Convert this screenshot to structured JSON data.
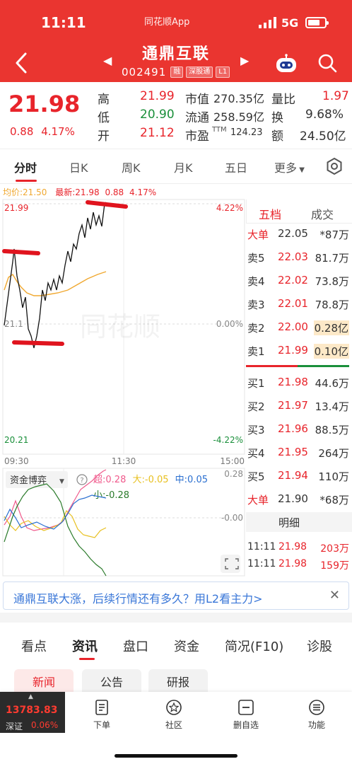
{
  "status": {
    "time": "11:11",
    "app": "同花顺App",
    "network": "5G"
  },
  "header": {
    "title": "通鼎互联",
    "code": "002491",
    "tags": [
      "融",
      "深股通",
      "L1"
    ]
  },
  "quote": {
    "price": "21.98",
    "change": "0.88",
    "change_pct": "4.17%",
    "high_label": "高",
    "high": "21.99",
    "low_label": "低",
    "low": "20.90",
    "open_label": "开",
    "open": "21.12",
    "mktcap_label": "市值",
    "mktcap": "270.35亿",
    "float_label": "流通",
    "float": "258.59亿",
    "pe_label": "市盈",
    "pe_sup": "TTM",
    "pe": "124.23",
    "volratio_label": "量比",
    "volratio": "1.97",
    "turnover_label": "换",
    "turnover": "9.68%",
    "amount_label": "额",
    "amount": "24.50亿"
  },
  "tabs": [
    "分时",
    "日K",
    "周K",
    "月K",
    "五日",
    "更多"
  ],
  "chart": {
    "avg_label": "均价:",
    "avg": "21.50",
    "latest_label": "最新:",
    "latest": "21.98",
    "latest_chg": "0.88",
    "latest_pct": "4.17%",
    "y_top": "21.99",
    "y_mid": "21.1",
    "y_bottom": "20.21",
    "pct_top": "4.22%",
    "pct_mid": "0.00%",
    "pct_bottom": "-4.22%",
    "x_start": "09:30",
    "x_mid": "11:30",
    "x_end": "15:00",
    "watermark": "同花顺",
    "fund_selector": "资金博弈",
    "fund_super_label": "超:",
    "fund_super": "0.28",
    "fund_big_label": "大:",
    "fund_big": "-0.05",
    "fund_mid_label": "中:",
    "fund_mid": "0.05",
    "fund_small_label": "小:",
    "fund_small": "-0.28",
    "fund_axis_top": "0.28",
    "fund_axis_mid": "-0.00",
    "colors": {
      "price": "#111111",
      "avg": "#f0a830",
      "super": "#f05a8c",
      "big": "#e8c020",
      "mid": "#2a6fd0",
      "small": "#2a7a2a",
      "annotation": "#e0141e"
    }
  },
  "orderbook": {
    "tabs": [
      "五档",
      "成交"
    ],
    "big_sell": {
      "label": "大单",
      "price": "22.05",
      "vol": "*87万"
    },
    "sells": [
      {
        "label": "卖5",
        "price": "22.03",
        "vol": "81.7万"
      },
      {
        "label": "卖4",
        "price": "22.02",
        "vol": "73.8万"
      },
      {
        "label": "卖3",
        "price": "22.01",
        "vol": "78.8万"
      },
      {
        "label": "卖2",
        "price": "22.00",
        "vol": "0.28亿"
      },
      {
        "label": "卖1",
        "price": "21.99",
        "vol": "0.10亿"
      }
    ],
    "buys": [
      {
        "label": "买1",
        "price": "21.98",
        "vol": "44.6万"
      },
      {
        "label": "买2",
        "price": "21.97",
        "vol": "13.4万"
      },
      {
        "label": "买3",
        "price": "21.96",
        "vol": "88.5万"
      },
      {
        "label": "买4",
        "price": "21.95",
        "vol": "264万"
      },
      {
        "label": "买5",
        "price": "21.94",
        "vol": "110万"
      }
    ],
    "big_buy": {
      "label": "大单",
      "price": "21.90",
      "vol": "*68万"
    },
    "detail_label": "明细",
    "trades": [
      {
        "time": "11:11",
        "price": "21.98",
        "vol": "203万"
      },
      {
        "time": "11:11",
        "price": "21.98",
        "vol": "159万"
      }
    ]
  },
  "banner": {
    "text": "通鼎互联大涨，后续行情还有多久？用L2看主力>"
  },
  "info_tabs": [
    "看点",
    "资讯",
    "盘口",
    "资金",
    "简况(F10)",
    "诊股"
  ],
  "sub_tabs": [
    "新闻",
    "公告",
    "研报"
  ],
  "bottom": {
    "index_value": "13783.83",
    "index_name": "深证",
    "index_pct": "0.06%",
    "nav": [
      "下单",
      "社区",
      "删自选",
      "功能"
    ]
  }
}
